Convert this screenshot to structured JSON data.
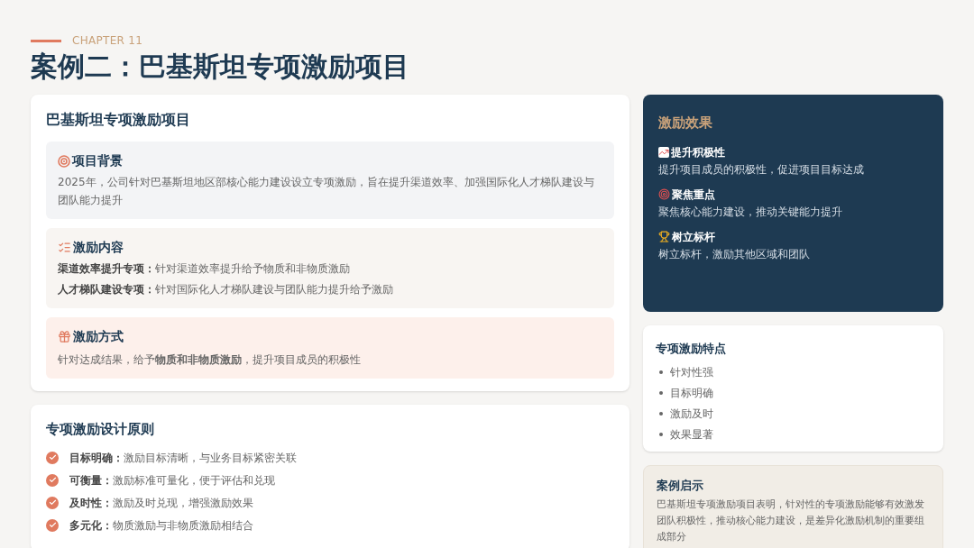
{
  "header": {
    "chapter": "CHAPTER 11",
    "title": "案例二：巴基斯坦专项激励项目"
  },
  "project": {
    "title": "巴基斯坦专项激励项目",
    "sections": [
      {
        "kind": "paragraph",
        "heading": "项目背景",
        "text": "2025年，公司针对巴基斯坦地区部核心能力建设设立专项激励，旨在提升渠道效率、加强国际化人才梯队建设与团队能力提升"
      },
      {
        "kind": "list",
        "heading": "激励内容",
        "items": [
          {
            "label": "渠道效率提升专项：",
            "text": "针对渠道效率提升给予物质和非物质激励"
          },
          {
            "label": "人才梯队建设专项：",
            "text": "针对国际化人才梯队建设与团队能力提升给予激励"
          }
        ]
      },
      {
        "kind": "highlight",
        "heading": "激励方式",
        "text": "针对达成结果，给予**物质和非物质激励**，提升项目成员的积极性"
      }
    ]
  },
  "principles": {
    "title": "专项激励设计原则",
    "items": [
      {
        "label": "目标明确：",
        "text": "激励目标清晰，与业务目标紧密关联"
      },
      {
        "label": "可衡量：",
        "text": "激励标准可量化，便于评估和兑现"
      },
      {
        "label": "及时性：",
        "text": "激励及时兑现，增强激励效果"
      },
      {
        "label": "多元化：",
        "text": "物质激励与非物质激励相结合"
      }
    ]
  },
  "effects": {
    "title": "激励效果",
    "items": [
      {
        "heading": "提升积极性",
        "text": "提升项目成员的积极性，促进项目目标达成"
      },
      {
        "heading": "聚焦重点",
        "text": "聚焦核心能力建设，推动关键能力提升"
      },
      {
        "heading": "树立标杆",
        "text": "树立标杆，激励其他区域和团队"
      }
    ]
  },
  "features": {
    "title": "专项激励特点",
    "items": [
      "针对性强",
      "目标明确",
      "激励及时",
      "效果显著"
    ]
  },
  "insight": {
    "title": "案例启示",
    "text": "巴基斯坦专项激励项目表明，针对性的专项激励能够有效激发团队积极性，推动核心能力建设，是差异化激励机制的重要组成部分"
  }
}
